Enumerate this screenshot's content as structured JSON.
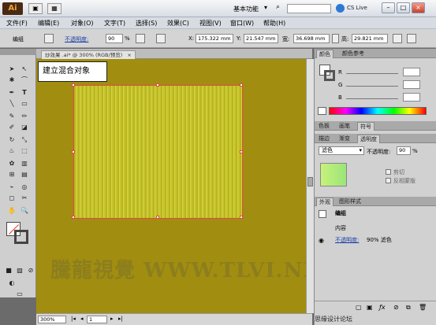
{
  "app": {
    "logo": "Ai",
    "workspace": "基本功能",
    "cslive": "CS Live"
  },
  "window_controls": {
    "min": "–",
    "max": "□",
    "close": "×"
  },
  "menu": [
    "文件(F)",
    "编辑(E)",
    "对象(O)",
    "文字(T)",
    "选择(S)",
    "效果(C)",
    "视图(V)",
    "窗口(W)",
    "帮助(H)"
  ],
  "control": {
    "group_label": "编组",
    "opacity_label": "不透明度:",
    "opacity_value": "90",
    "opacity_unit": "%",
    "x_label": "X:",
    "x_value": "175.322 mm",
    "y_label": "Y:",
    "y_value": "21.547 mm",
    "w_label": "宽:",
    "w_value": "36.698 mm",
    "h_label": "高:",
    "h_value": "29.821 mm"
  },
  "document": {
    "tab_label": "炒效果 .ai* @ 300% (RGB/预览)",
    "tab_close": "×",
    "tooltip": "建立混合对象",
    "watermark": "騰龍視覺 WWW.TLVI.NET"
  },
  "status": {
    "zoom": "300%",
    "page": "1"
  },
  "panels": {
    "color_tabs": [
      "颜色",
      "颜色参考"
    ],
    "color_channels": [
      "R",
      "G",
      "B"
    ],
    "swatch_tabs": [
      "色板",
      "画笔",
      "符号"
    ],
    "transparency_tabs": [
      "描边",
      "渐变",
      "透明度"
    ],
    "blend_mode": "滤色",
    "transparency_label": "不透明度:",
    "transparency_value": "90",
    "transparency_unit": "%",
    "clip_label": "剪切",
    "invert_label": "反相蒙版",
    "appearance_tabs": [
      "外观",
      "图形样式"
    ],
    "appearance_group": "编组",
    "appearance_content": "内容",
    "appearance_opacity_link": "不透明度:",
    "appearance_opacity_value": "90% 滤色",
    "bottom_text": "思缘设计论坛"
  },
  "tools": [
    "select-arrow",
    "direct-select",
    "magic-wand",
    "lasso",
    "pen",
    "type",
    "line",
    "rect",
    "brush",
    "pencil",
    "blob",
    "eraser",
    "rotate",
    "scale",
    "warp",
    "free-transform",
    "symbol",
    "graph",
    "mesh",
    "gradient",
    "eyedropper",
    "blend",
    "slice",
    "scissors",
    "hand",
    "zoom"
  ]
}
